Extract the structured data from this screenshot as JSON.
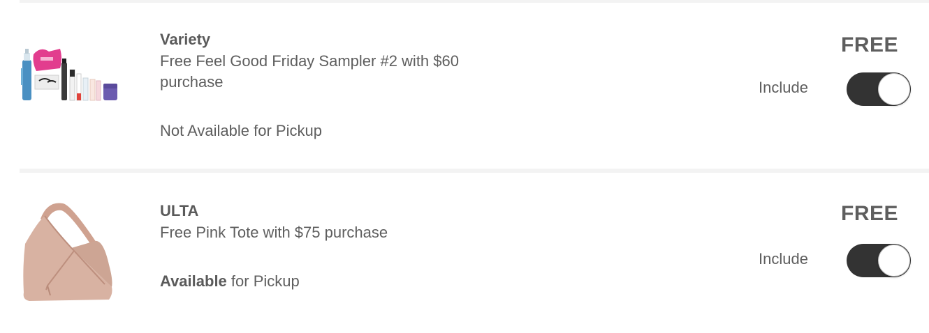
{
  "items": [
    {
      "brand": "Variety",
      "description": "Free Feel Good Friday Sampler #2 with $60 purchase",
      "pickup": {
        "strong": "",
        "text": "Not Available for Pickup"
      },
      "price": "FREE",
      "include_label": "Include",
      "include_on": true,
      "image_icon": "beauty-sampler-set-image"
    },
    {
      "brand": "ULTA",
      "description": "Free Pink Tote with $75 purchase",
      "pickup": {
        "strong": "Available",
        "text": " for Pickup"
      },
      "price": "FREE",
      "include_label": "Include",
      "include_on": true,
      "image_icon": "pink-tote-bag-image"
    }
  ],
  "colors": {
    "toggle_on": "#333333",
    "text": "#5e5e5e",
    "divider": "#f3f3f3",
    "tote": "#d8b2a2"
  }
}
